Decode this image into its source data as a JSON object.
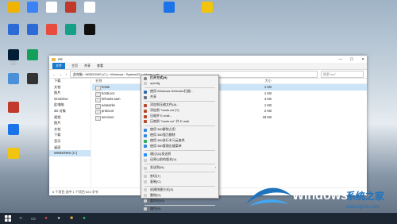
{
  "desktop": {
    "icons": [
      {
        "label": "",
        "color": "#f0b400"
      },
      {
        "label": "",
        "color": "#3b82f6"
      },
      {
        "label": "",
        "color": "#ffffff"
      },
      {
        "label": "",
        "color": "#c0392b"
      },
      {
        "label": "",
        "color": "#ffffff"
      },
      {
        "label": "",
        "color": "#2c6bd6"
      },
      {
        "label": "",
        "color": "#2c6bd6"
      },
      {
        "label": "",
        "color": "#e74c3c"
      },
      {
        "label": "",
        "color": "#16a085"
      },
      {
        "label": "",
        "color": "#111111"
      },
      {
        "label": "PS",
        "color": "#001e36"
      },
      {
        "label": "",
        "color": "#14a05a"
      },
      {
        "label": "",
        "color": "#4a90d9"
      },
      {
        "label": "",
        "color": "#333333"
      },
      {
        "label": "",
        "color": "#c0392b"
      },
      {
        "label": "",
        "color": "#1a73e8"
      },
      {
        "label": "",
        "color": "#f1c40f"
      },
      {
        "label": "",
        "color": "#1a73e8"
      },
      {
        "label": "",
        "color": "#f1c40f"
      }
    ]
  },
  "explorer": {
    "title": "etc",
    "ribbon_tabs": [
      "文件",
      "主页",
      "共享",
      "查看"
    ],
    "address": "此电脑 › WINDOWS (C:) › Windows › System32 › drivers › etc",
    "search_placeholder": "搜索\"etc\"",
    "nav_items": [
      "下载",
      "文档",
      "图片",
      "OneDrive",
      "此电脑",
      "3D 对象",
      "视频",
      "图片",
      "文档",
      "下载",
      "音乐",
      "桌面",
      "WINDOWS (C:)"
    ],
    "column_name": "名称",
    "column_size": "大小",
    "files": [
      {
        "name": "hosts",
        "size": "1 KB"
      },
      {
        "name": "hosts.ics",
        "size": "1 KB"
      },
      {
        "name": "lmhosts.sam",
        "size": "4 KB"
      },
      {
        "name": "networks",
        "size": "1 KB"
      },
      {
        "name": "protocol",
        "size": "2 KB"
      },
      {
        "name": "services",
        "size": "18 KB"
      }
    ],
    "status": "6 个项目   选中 1 个项目  824 字节"
  },
  "context_menu": {
    "items": [
      {
        "label": "打开方式(H)",
        "bold": true,
        "color": "#888888"
      },
      {
        "label": "openfg",
        "color": "#cccccc"
      },
      {
        "label": "使用 Windows Defender扫描...",
        "color": "#2b6cb0"
      },
      {
        "label": "共享",
        "color": "#6b7280"
      },
      {
        "label": "添加到压缩文件(A)...",
        "color": "#b7472a"
      },
      {
        "label": "添加到 \"hosts.rar\"(T)",
        "color": "#b7472a"
      },
      {
        "label": "压缩并 E-mail...",
        "color": "#b7472a"
      },
      {
        "label": "压缩到 \"hosts.rar\" 并 E-mail",
        "color": "#b7472a"
      },
      {
        "label": "使用 360解除占用",
        "color": "#2e86de"
      },
      {
        "label": "使用 360强力删除",
        "color": "#2e86de"
      },
      {
        "label": "使用 360进行木马云查杀",
        "color": "#27ae60"
      },
      {
        "label": "使用 360管理右键菜单",
        "color": "#2e86de"
      },
      {
        "label": "通过QQ发送到",
        "color": "#1e90ff"
      },
      {
        "label": "还原以前的版本(V)",
        "color": "#cccccc"
      },
      {
        "label": "发送到(N)",
        "color": "#cccccc",
        "submenu": true
      },
      {
        "label": "剪切(T)",
        "color": "#cccccc"
      },
      {
        "label": "复制(C)",
        "color": "#cccccc"
      },
      {
        "label": "创建快捷方式(S)",
        "color": "#cccccc"
      },
      {
        "label": "删除(D)",
        "color": "#cccccc"
      },
      {
        "label": "重命名(M)",
        "color": "#cccccc"
      },
      {
        "label": "属性(R)",
        "color": "#cccccc"
      }
    ]
  },
  "watermark": {
    "title": "Windows",
    "subtitle_cn": "系统之家",
    "url": "www.bjjmlv.com",
    "brand_color": "#1e73be"
  },
  "taskbar": {
    "start_icon": "windows-logo-icon",
    "accent": "#1d2733"
  }
}
